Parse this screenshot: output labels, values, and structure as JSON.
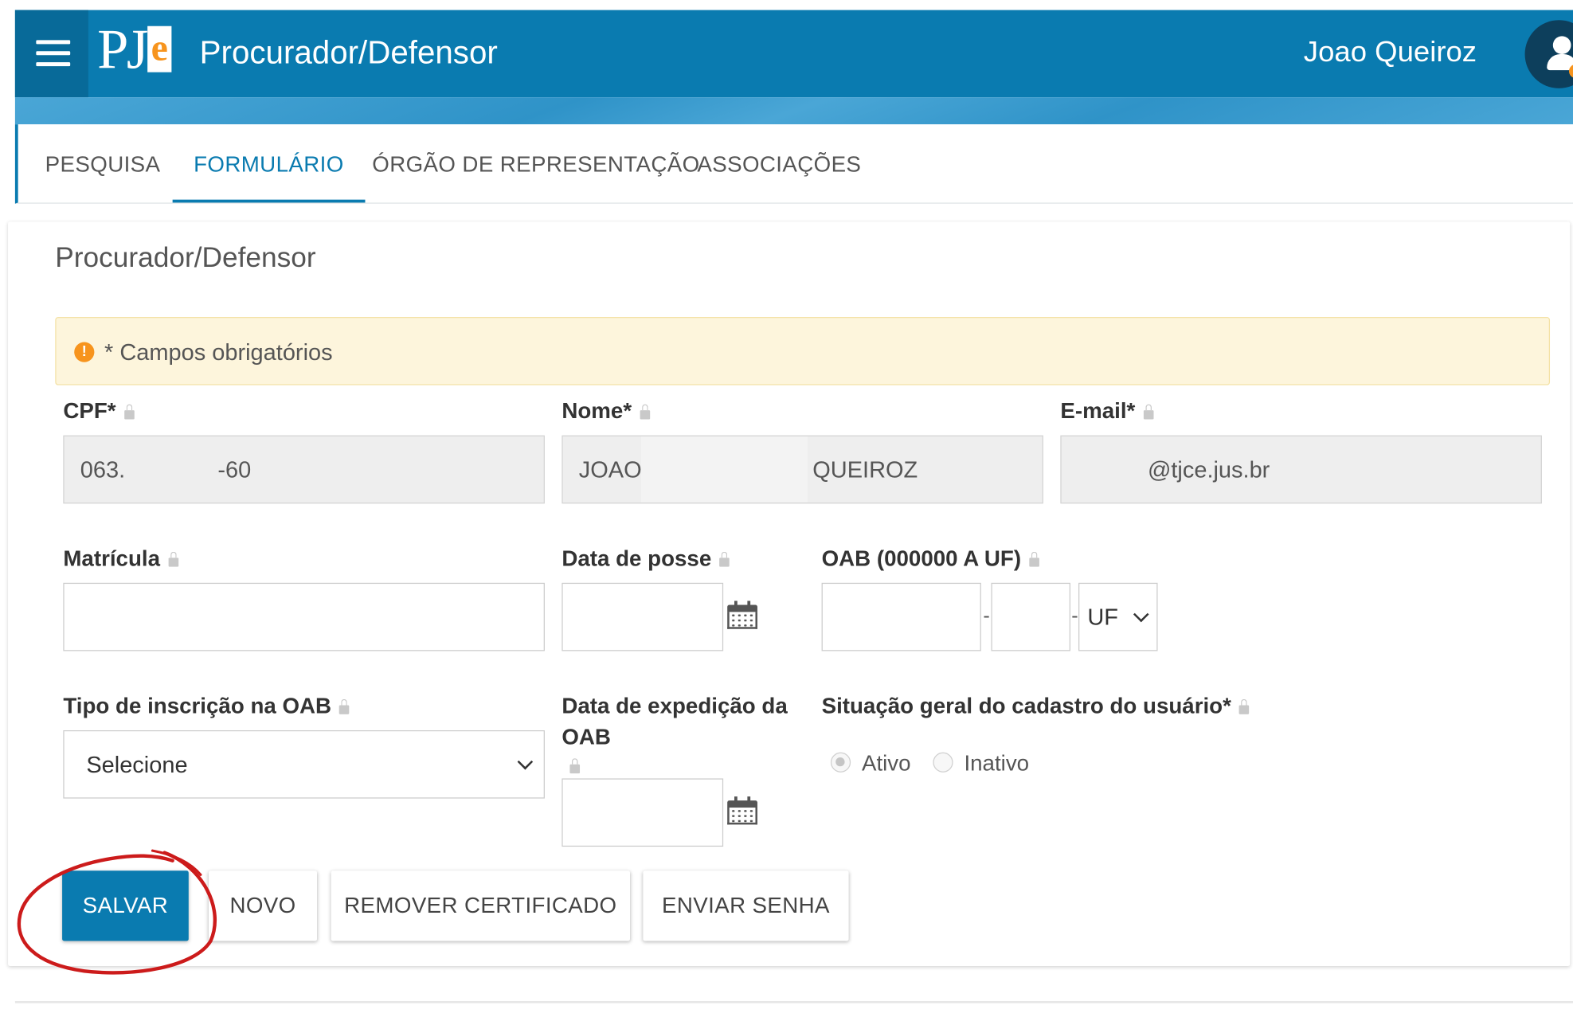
{
  "header": {
    "logo_text": "PJe",
    "app_title": "Procurador/Defensor",
    "user_name": "Joao Queiroz",
    "menu_icon": "hamburger-menu-icon",
    "avatar_icon": "user-avatar-icon"
  },
  "tabs": [
    {
      "label": "PESQUISA",
      "active": false
    },
    {
      "label": "FORMULÁRIO",
      "active": true
    },
    {
      "label": "ÓRGÃO DE REPRESENTAÇÃO",
      "active": false
    },
    {
      "label": "ASSOCIAÇÕES",
      "active": false
    }
  ],
  "form": {
    "title": "Procurador/Defensor",
    "alert": "* Campos obrigatórios",
    "cpf": {
      "label": "CPF*",
      "value_start": "063.",
      "value_end": "-60"
    },
    "nome": {
      "label": "Nome*",
      "value_start": "JOAO",
      "value_end": "QUEIROZ"
    },
    "email": {
      "label": "E-mail*",
      "value": "@tjce.jus.br"
    },
    "matricula": {
      "label": "Matrícula",
      "value": ""
    },
    "data_posse": {
      "label": "Data de posse",
      "value": ""
    },
    "oab": {
      "label": "OAB (000000 A UF)",
      "separator": "-",
      "uf_placeholder": "UF"
    },
    "tipo_inscricao": {
      "label": "Tipo de inscrição na OAB",
      "selected": "Selecione"
    },
    "data_expedicao": {
      "label_line1": "Data de expedição da",
      "label_line2": "OAB",
      "value": ""
    },
    "situacao": {
      "label": "Situação geral do cadastro do usuário*",
      "options": [
        {
          "label": "Ativo",
          "checked": true
        },
        {
          "label": "Inativo",
          "checked": false
        }
      ]
    }
  },
  "buttons": {
    "salvar": "SALVAR",
    "novo": "NOVO",
    "remover_certificado": "REMOVER CERTIFICADO",
    "enviar_senha": "ENVIAR SENHA"
  },
  "colors": {
    "header_blue": "#0a7bb0",
    "accent_orange": "#f7941d",
    "alert_background": "#fdf5dc",
    "annotation_red": "#cc1b1b"
  }
}
